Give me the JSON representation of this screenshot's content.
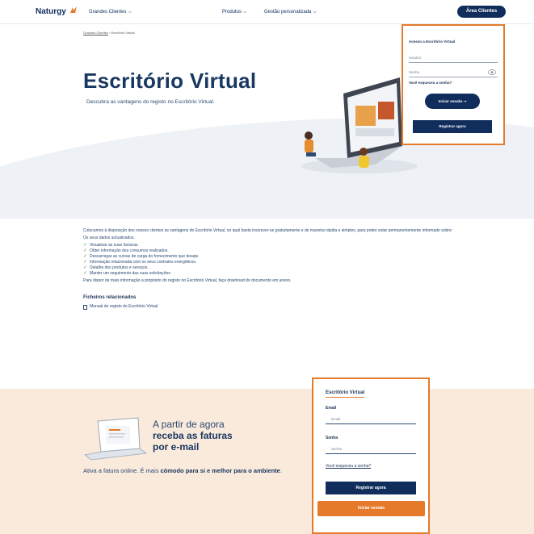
{
  "header": {
    "logo": "Naturgy",
    "nav": [
      "Grandes Clientes",
      "Produtos",
      "Gestão personalizada"
    ],
    "area_button": "Área Clientes"
  },
  "breadcrumb": [
    "Grandes Clientes",
    "Escritório Virtual"
  ],
  "hero": {
    "title": "Escritório Virtual",
    "subtitle": "Descubra as vantagens do registo no Escritório Virtual."
  },
  "login_top": {
    "title": "Acesso a Escritório Virtual",
    "user_placeholder": "Usuário",
    "password_placeholder": "Senha",
    "forgot": "Você esqueceu a senha?",
    "login_button": "Iniciar sessão",
    "register_button": "Registrar agora"
  },
  "content": {
    "intro": "Colocamos à disposição dos nossos clientes as vantagens do Escritório Virtual, no qual basta inscrever-se gratuitamente e de maneira rápida e simples, para poder estar permanentemente informado sobre:",
    "data_line": "Os seus dados actualizados.",
    "items": [
      "Visualizar as suas facturas.",
      "Obter informação dos consumos realizados.",
      "Descarregar as curvas de carga do fornecimento que deseje.",
      "Informação relacionada com os seus contratos energéticos.",
      "Detalhe dos produtos e serviços.",
      "Manter um seguimento das suas solicitações."
    ],
    "outro": "Para dispor de mais informação a propósito do registo no Escritório Virtual, faça download do documento em anexo.",
    "files_title": "Ficheiros relacionados",
    "file_link": "Manual de registo do Escritório Virtual"
  },
  "promo": {
    "line1": "A partir de agora",
    "line2": "receba as faturas",
    "line3": "por e-mail",
    "text_plain": "Ativa a fatura online. É mais ",
    "text_bold": "cómodo para si e melhor para o ambiente",
    "text_end": "."
  },
  "login_bottom": {
    "title": "Escritório Virtual",
    "email_label": "Email",
    "email_placeholder": "Email",
    "password_label": "Senha",
    "password_placeholder": "Senha",
    "forgot": "Você esqueceu a senha?",
    "register_button": "Registrar agora",
    "login_button": "Iniciar sessão"
  },
  "colors": {
    "brand_navy": "#102d5c",
    "accent_orange": "#e57a2b",
    "band_bg": "#faeadb",
    "check_green": "#5aa64f"
  }
}
